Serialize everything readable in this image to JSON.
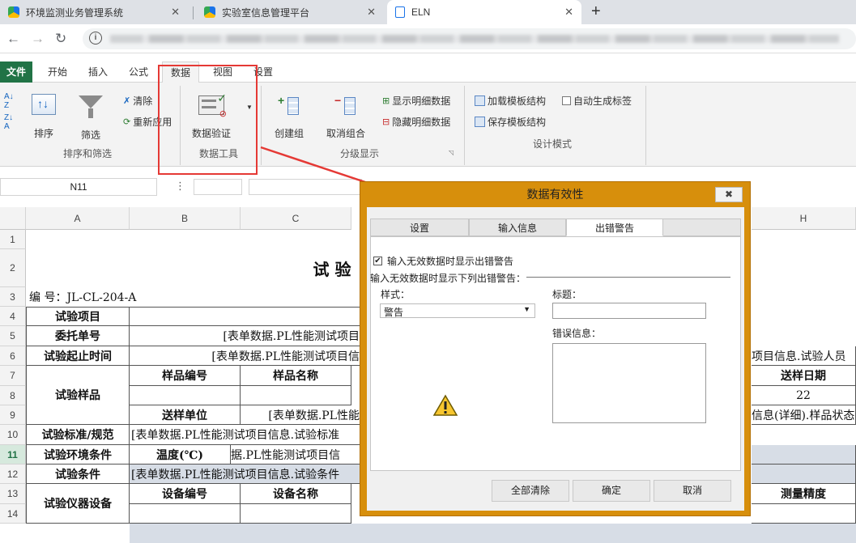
{
  "browser": {
    "tabs": [
      {
        "label": "环境监测业务管理系统"
      },
      {
        "label": "实验室信息管理平台"
      },
      {
        "label": "ELN"
      }
    ],
    "new_tab": "+",
    "info_icon": "i"
  },
  "ribbon": {
    "tabs": [
      "文件",
      "开始",
      "插入",
      "公式",
      "数据",
      "视图",
      "设置"
    ],
    "sort_filter": {
      "sort": "排序",
      "filter": "筛选",
      "clear": "清除",
      "reapply": "重新应用",
      "group": "排序和筛选"
    },
    "data_tools": {
      "validation": "数据验证",
      "group": "数据工具"
    },
    "outline": {
      "group_btn": "创建组",
      "ungroup": "取消组合",
      "show_detail": "显示明细数据",
      "hide_detail": "隐藏明细数据",
      "group": "分级显示"
    },
    "design": {
      "load": "加载模板结构",
      "save": "保存模板结构",
      "auto_tag": "自动生成标签",
      "group": "设计模式"
    }
  },
  "formula_bar": {
    "name_box": "N11"
  },
  "sheet": {
    "columns": [
      "A",
      "B",
      "C",
      "H"
    ],
    "rows": [
      "1",
      "2",
      "3",
      "4",
      "5",
      "6",
      "7",
      "8",
      "9",
      "10",
      "11",
      "12",
      "13",
      "14"
    ],
    "cells": {
      "title": "试 验",
      "code": "编 号：JL-CL-204-A",
      "r4a": "试验项目",
      "r5a": "委托单号",
      "r5b": "[表单数据.PL性能测试项目",
      "r6a": "试验起止时间",
      "r6b": "[表单数据.PL性能测试项目信",
      "r6h": "项目信息.试验人员",
      "r7a": "试验样品",
      "r7b": "样品编号",
      "r7c": "样品名称",
      "r7h": "送样日期",
      "r8h": "22",
      "r9b": "送样单位",
      "r9c": "[表单数据.PL性能",
      "r9h": "信息(详细).样品状态",
      "r10a": "试验标准/规范",
      "r10b": "[表单数据.PL性能测试项目信息.试验标准",
      "r11a": "试验环境条件",
      "r11b": "温度(℃)",
      "r11c": "据.PL性能测试项目信",
      "r12a": "试验条件",
      "r12b": "[表单数据.PL性能测试项目信息.试验条件",
      "r13a": "试验仪器设备",
      "r13b": "设备编号",
      "r13c": "设备名称",
      "r13h": "测量精度"
    }
  },
  "dialog": {
    "title": "数据有效性",
    "close": "✖",
    "tabs": [
      "设置",
      "输入信息",
      "出错警告"
    ],
    "checkbox_label": "输入无效数据时显示出错警告",
    "section_label": "输入无效数据时显示下列出错警告：",
    "style_label": "样式：",
    "style_value": "警告",
    "title_label": "标题：",
    "error_label": "错误信息：",
    "buttons": {
      "clear": "全部清除",
      "ok": "确定",
      "cancel": "取消"
    }
  },
  "colors": {
    "accent": "#217346",
    "dialog_frame": "#d78f0c",
    "highlight": "#e53935"
  }
}
